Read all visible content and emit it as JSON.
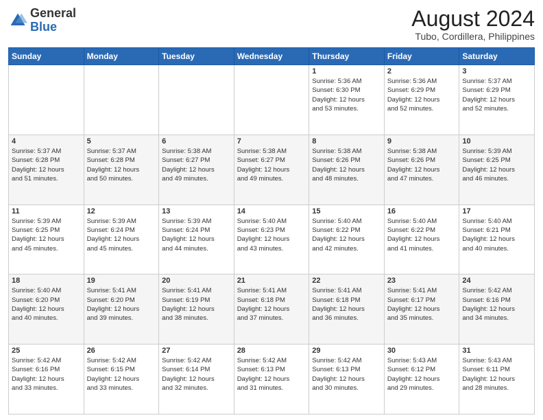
{
  "header": {
    "logo_general": "General",
    "logo_blue": "Blue",
    "month_year": "August 2024",
    "location": "Tubo, Cordillera, Philippines"
  },
  "days_of_week": [
    "Sunday",
    "Monday",
    "Tuesday",
    "Wednesday",
    "Thursday",
    "Friday",
    "Saturday"
  ],
  "weeks": [
    [
      {
        "day": "",
        "info": ""
      },
      {
        "day": "",
        "info": ""
      },
      {
        "day": "",
        "info": ""
      },
      {
        "day": "",
        "info": ""
      },
      {
        "day": "1",
        "info": "Sunrise: 5:36 AM\nSunset: 6:30 PM\nDaylight: 12 hours\nand 53 minutes."
      },
      {
        "day": "2",
        "info": "Sunrise: 5:36 AM\nSunset: 6:29 PM\nDaylight: 12 hours\nand 52 minutes."
      },
      {
        "day": "3",
        "info": "Sunrise: 5:37 AM\nSunset: 6:29 PM\nDaylight: 12 hours\nand 52 minutes."
      }
    ],
    [
      {
        "day": "4",
        "info": "Sunrise: 5:37 AM\nSunset: 6:28 PM\nDaylight: 12 hours\nand 51 minutes."
      },
      {
        "day": "5",
        "info": "Sunrise: 5:37 AM\nSunset: 6:28 PM\nDaylight: 12 hours\nand 50 minutes."
      },
      {
        "day": "6",
        "info": "Sunrise: 5:38 AM\nSunset: 6:27 PM\nDaylight: 12 hours\nand 49 minutes."
      },
      {
        "day": "7",
        "info": "Sunrise: 5:38 AM\nSunset: 6:27 PM\nDaylight: 12 hours\nand 49 minutes."
      },
      {
        "day": "8",
        "info": "Sunrise: 5:38 AM\nSunset: 6:26 PM\nDaylight: 12 hours\nand 48 minutes."
      },
      {
        "day": "9",
        "info": "Sunrise: 5:38 AM\nSunset: 6:26 PM\nDaylight: 12 hours\nand 47 minutes."
      },
      {
        "day": "10",
        "info": "Sunrise: 5:39 AM\nSunset: 6:25 PM\nDaylight: 12 hours\nand 46 minutes."
      }
    ],
    [
      {
        "day": "11",
        "info": "Sunrise: 5:39 AM\nSunset: 6:25 PM\nDaylight: 12 hours\nand 45 minutes."
      },
      {
        "day": "12",
        "info": "Sunrise: 5:39 AM\nSunset: 6:24 PM\nDaylight: 12 hours\nand 45 minutes."
      },
      {
        "day": "13",
        "info": "Sunrise: 5:39 AM\nSunset: 6:24 PM\nDaylight: 12 hours\nand 44 minutes."
      },
      {
        "day": "14",
        "info": "Sunrise: 5:40 AM\nSunset: 6:23 PM\nDaylight: 12 hours\nand 43 minutes."
      },
      {
        "day": "15",
        "info": "Sunrise: 5:40 AM\nSunset: 6:22 PM\nDaylight: 12 hours\nand 42 minutes."
      },
      {
        "day": "16",
        "info": "Sunrise: 5:40 AM\nSunset: 6:22 PM\nDaylight: 12 hours\nand 41 minutes."
      },
      {
        "day": "17",
        "info": "Sunrise: 5:40 AM\nSunset: 6:21 PM\nDaylight: 12 hours\nand 40 minutes."
      }
    ],
    [
      {
        "day": "18",
        "info": "Sunrise: 5:40 AM\nSunset: 6:20 PM\nDaylight: 12 hours\nand 40 minutes."
      },
      {
        "day": "19",
        "info": "Sunrise: 5:41 AM\nSunset: 6:20 PM\nDaylight: 12 hours\nand 39 minutes."
      },
      {
        "day": "20",
        "info": "Sunrise: 5:41 AM\nSunset: 6:19 PM\nDaylight: 12 hours\nand 38 minutes."
      },
      {
        "day": "21",
        "info": "Sunrise: 5:41 AM\nSunset: 6:18 PM\nDaylight: 12 hours\nand 37 minutes."
      },
      {
        "day": "22",
        "info": "Sunrise: 5:41 AM\nSunset: 6:18 PM\nDaylight: 12 hours\nand 36 minutes."
      },
      {
        "day": "23",
        "info": "Sunrise: 5:41 AM\nSunset: 6:17 PM\nDaylight: 12 hours\nand 35 minutes."
      },
      {
        "day": "24",
        "info": "Sunrise: 5:42 AM\nSunset: 6:16 PM\nDaylight: 12 hours\nand 34 minutes."
      }
    ],
    [
      {
        "day": "25",
        "info": "Sunrise: 5:42 AM\nSunset: 6:16 PM\nDaylight: 12 hours\nand 33 minutes."
      },
      {
        "day": "26",
        "info": "Sunrise: 5:42 AM\nSunset: 6:15 PM\nDaylight: 12 hours\nand 33 minutes."
      },
      {
        "day": "27",
        "info": "Sunrise: 5:42 AM\nSunset: 6:14 PM\nDaylight: 12 hours\nand 32 minutes."
      },
      {
        "day": "28",
        "info": "Sunrise: 5:42 AM\nSunset: 6:13 PM\nDaylight: 12 hours\nand 31 minutes."
      },
      {
        "day": "29",
        "info": "Sunrise: 5:42 AM\nSunset: 6:13 PM\nDaylight: 12 hours\nand 30 minutes."
      },
      {
        "day": "30",
        "info": "Sunrise: 5:43 AM\nSunset: 6:12 PM\nDaylight: 12 hours\nand 29 minutes."
      },
      {
        "day": "31",
        "info": "Sunrise: 5:43 AM\nSunset: 6:11 PM\nDaylight: 12 hours\nand 28 minutes."
      }
    ]
  ]
}
